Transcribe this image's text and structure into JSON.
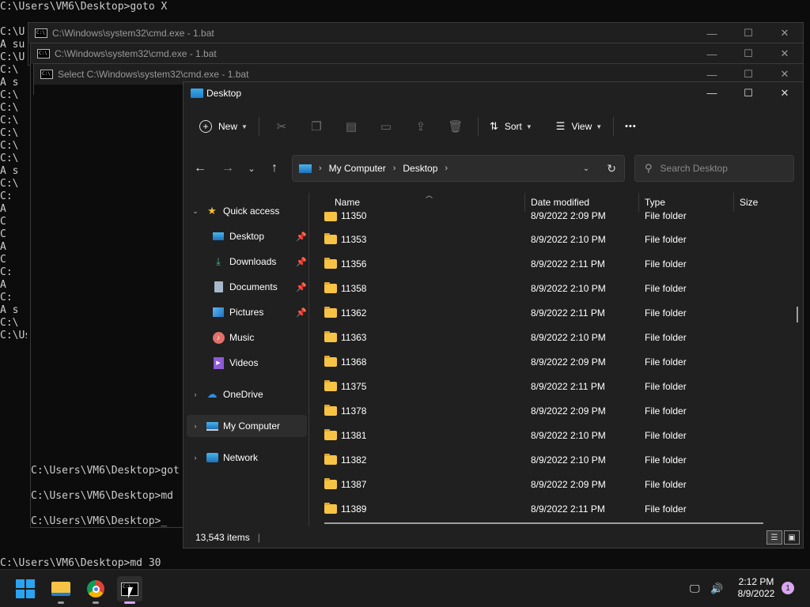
{
  "background_console": {
    "top_line": "C:\\Users\\VM6\\Desktop>goto X",
    "fragments": [
      "C:\\U",
      "A su",
      "C:\\U",
      "C:\\",
      "A s",
      "C:\\",
      "C:\\",
      "C:\\",
      "C:\\",
      "C:\\",
      "C:\\",
      "A s",
      "C:\\",
      "C:",
      "A",
      "C",
      "C",
      "A",
      "C",
      "C:",
      "A",
      "C:",
      "A s",
      "C:\\",
      "C:\\Us"
    ],
    "bottom_line": "C:\\Users\\VM6\\Desktop>md 30"
  },
  "cmd_windows": [
    {
      "title": "C:\\Windows\\system32\\cmd.exe - 1.bat"
    },
    {
      "title": "C:\\Windows\\system32\\cmd.exe - 1.bat"
    },
    {
      "title": "Select C:\\Windows\\system32\\cmd.exe - 1.bat"
    }
  ],
  "cmd_visible_lines": [
    "C:\\Users\\VM6\\Desktop>got",
    "C:\\Users\\VM6\\Desktop>md",
    "C:\\Users\\VM6\\Desktop>_"
  ],
  "explorer": {
    "title": "Desktop",
    "toolbar": {
      "new_label": "New",
      "sort_label": "Sort",
      "view_label": "View",
      "more_label": "•••"
    },
    "address": {
      "crumbs": [
        "My Computer",
        "Desktop"
      ]
    },
    "search": {
      "placeholder": "Search Desktop"
    },
    "sidebar": {
      "quick_access": "Quick access",
      "items": [
        {
          "label": "Desktop",
          "icon": "desktop-icon",
          "pinned": true
        },
        {
          "label": "Downloads",
          "icon": "download-icon",
          "pinned": true
        },
        {
          "label": "Documents",
          "icon": "document-icon",
          "pinned": true
        },
        {
          "label": "Pictures",
          "icon": "picture-icon",
          "pinned": true
        },
        {
          "label": "Music",
          "icon": "music-icon",
          "pinned": false
        },
        {
          "label": "Videos",
          "icon": "video-icon",
          "pinned": false
        }
      ],
      "onedrive": "OneDrive",
      "my_computer": "My Computer",
      "network": "Network"
    },
    "columns": {
      "name": "Name",
      "date": "Date modified",
      "type": "Type",
      "size": "Size"
    },
    "rows": [
      {
        "name": "11350",
        "date": "8/9/2022 2:09 PM",
        "type": "File folder"
      },
      {
        "name": "11353",
        "date": "8/9/2022 2:10 PM",
        "type": "File folder"
      },
      {
        "name": "11356",
        "date": "8/9/2022 2:11 PM",
        "type": "File folder"
      },
      {
        "name": "11358",
        "date": "8/9/2022 2:10 PM",
        "type": "File folder"
      },
      {
        "name": "11362",
        "date": "8/9/2022 2:11 PM",
        "type": "File folder"
      },
      {
        "name": "11363",
        "date": "8/9/2022 2:10 PM",
        "type": "File folder"
      },
      {
        "name": "11368",
        "date": "8/9/2022 2:09 PM",
        "type": "File folder"
      },
      {
        "name": "11375",
        "date": "8/9/2022 2:11 PM",
        "type": "File folder"
      },
      {
        "name": "11378",
        "date": "8/9/2022 2:09 PM",
        "type": "File folder"
      },
      {
        "name": "11381",
        "date": "8/9/2022 2:10 PM",
        "type": "File folder"
      },
      {
        "name": "11382",
        "date": "8/9/2022 2:10 PM",
        "type": "File folder"
      },
      {
        "name": "11387",
        "date": "8/9/2022 2:09 PM",
        "type": "File folder"
      },
      {
        "name": "11389",
        "date": "8/9/2022 2:11 PM",
        "type": "File folder"
      }
    ],
    "status": {
      "item_count": "13,543 items",
      "separator": "|"
    }
  },
  "taskbar": {
    "clock_time": "2:12 PM",
    "clock_date": "8/9/2022",
    "notification_count": "1"
  },
  "colors": {
    "folder_yellow": "#f7c345",
    "accent_blue": "#3fa9e8",
    "window_bg": "#202020",
    "console_bg": "#0c0c0c"
  }
}
